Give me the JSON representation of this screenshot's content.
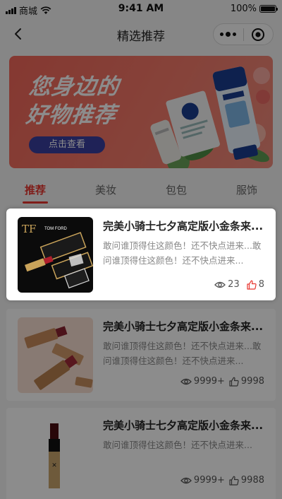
{
  "status_bar": {
    "carrier": "商城",
    "time": "9:41 AM",
    "battery": "100%"
  },
  "nav": {
    "title": "精选推荐"
  },
  "banner": {
    "line1": "您身边的",
    "line2": "好物推荐",
    "button": "点击查看"
  },
  "tabs": [
    {
      "label": "推荐",
      "active": true
    },
    {
      "label": "美妆",
      "active": false
    },
    {
      "label": "包包",
      "active": false
    },
    {
      "label": "服饰",
      "active": false
    }
  ],
  "cards": [
    {
      "title": "完美小骑士七夕高定版小金条来...",
      "desc": "敢问谁顶得住这颜色！还不快点进来...敢问谁顶得住这颜色！还不快点进来...",
      "views": "23",
      "likes": "8",
      "brand_text": "TOM FORD",
      "highlighted": true
    },
    {
      "title": "完美小骑士七夕高定版小金条来...",
      "desc": "敢问谁顶得住这颜色！还不快点进来...敢问谁顶得住这颜色！还不快点进来...",
      "views": "9999+",
      "likes": "9998",
      "highlighted": false
    },
    {
      "title": "完美小骑士七夕高定版小金条来...",
      "desc": "敢问谁顶得住这颜色！还不快点进来...",
      "views": "9999+",
      "likes": "9988",
      "highlighted": false
    }
  ],
  "colors": {
    "accent": "#e8362f",
    "banner_button": "#3a3f9e"
  }
}
